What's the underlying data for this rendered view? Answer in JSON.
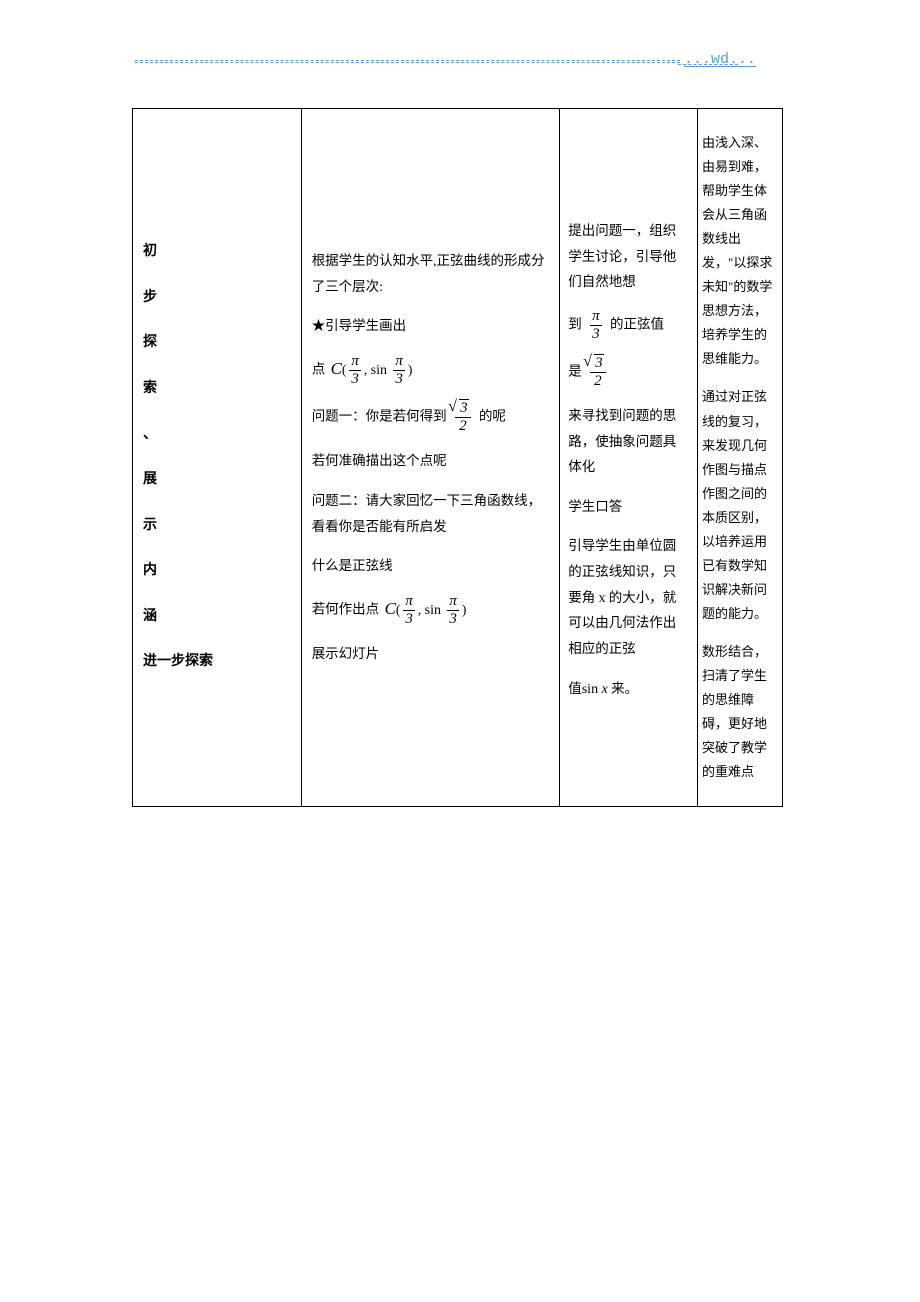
{
  "header": {
    "wd": "...wd..."
  },
  "col1": {
    "chars": [
      "初",
      "步",
      "探",
      "索",
      "、",
      "展",
      "示",
      "内",
      "涵"
    ],
    "last": "进一步探索"
  },
  "col2": {
    "p1": "根据学生的认知水平,正弦曲线的形成分了三个层次:",
    "p2": "★引导学生画出",
    "p3_pre": "点",
    "p4_pre": "问题一：你是若何得到",
    "p4_post": "的呢",
    "p5": "若何准确描出这个点呢",
    "p6": "问题二：请大家回忆一下三角函数线，看看你是否能有所启发",
    "p7": "什么是正弦线",
    "p8_pre": "若何作出点",
    "p9": "展示幻灯片"
  },
  "col3": {
    "p1": "提出问题一，组织学生讨论，引导他们自然地想",
    "p2_pre": "到",
    "p2_post": "的正弦值",
    "p3_pre": "是",
    "p4": "来寻找到问题的思路，使抽象问题具体化",
    "p5": "学生口答",
    "p6": "引导学生由单位圆的正弦线知识，只要角 x 的大小，就可以由几何法作出相应的正弦",
    "p7_pre": "值",
    "p7_post": "来。"
  },
  "col4": {
    "p1": "由浅入深、由易到难，帮助学生体会从三角函数线出发，\"以探求未知\"的数学思想方法，培养学生的思维能力。",
    "p2": "通过对正弦线的复习，来发现几何作图与描点作图之间的本质区别，以培养运用已有数学知识解决新问题的能力。",
    "p3": "数形结合，扫清了学生的思维障碍，更好地突破了教学的重难点"
  }
}
